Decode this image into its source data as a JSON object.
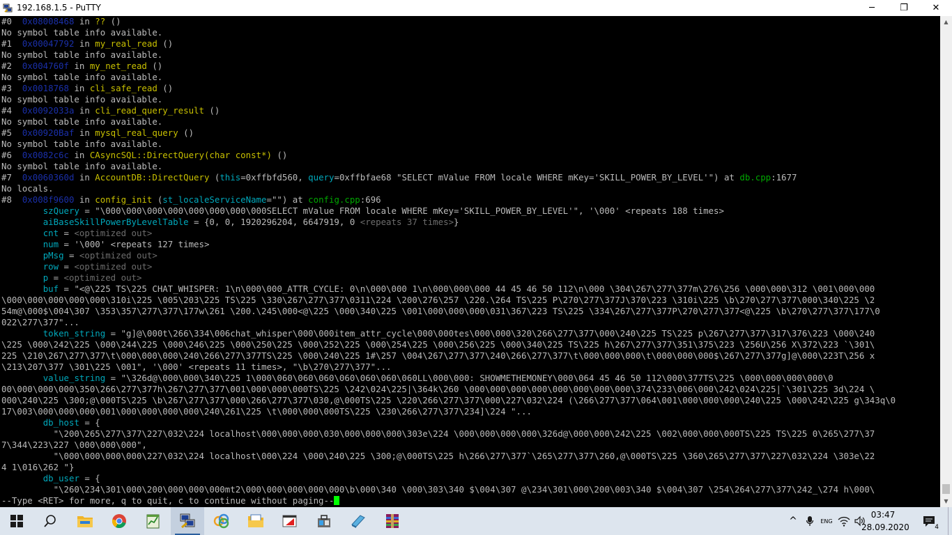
{
  "window": {
    "title": "192.168.1.5 - PuTTY",
    "icon": "putty-icon",
    "controls": {
      "minimize": "─",
      "maximize": "❐",
      "close": "✕"
    }
  },
  "terminal": {
    "colors": {
      "background": "#000000",
      "text": "#bbbbbb",
      "address": "#1a2fa8",
      "function": "#c8c000",
      "variable": "#00a8bb",
      "file": "#00a800",
      "dim": "#6d6d6d",
      "cursor": "#00ff00"
    },
    "lines": [
      [
        [
          "#0  ",
          "norm"
        ],
        [
          "0x08008468",
          "addr"
        ],
        [
          " in ",
          "norm"
        ],
        [
          "??",
          "func"
        ],
        [
          " ()",
          "norm"
        ]
      ],
      [
        [
          "No symbol table info available.",
          "norm"
        ]
      ],
      [
        [
          "#1  ",
          "norm"
        ],
        [
          "0x00047792",
          "addr"
        ],
        [
          " in ",
          "norm"
        ],
        [
          "my_real_read",
          "func"
        ],
        [
          " ()",
          "norm"
        ]
      ],
      [
        [
          "No symbol table info available.",
          "norm"
        ]
      ],
      [
        [
          "#2  ",
          "norm"
        ],
        [
          "0x004760f",
          "addr"
        ],
        [
          " in ",
          "norm"
        ],
        [
          "my_net_read",
          "func"
        ],
        [
          " ()",
          "norm"
        ]
      ],
      [
        [
          "No symbol table info available.",
          "norm"
        ]
      ],
      [
        [
          "#3  ",
          "norm"
        ],
        [
          "0x0018768",
          "addr"
        ],
        [
          " in ",
          "norm"
        ],
        [
          "cli_safe_read",
          "func"
        ],
        [
          " ()",
          "norm"
        ]
      ],
      [
        [
          "No symbol table info available.",
          "norm"
        ]
      ],
      [
        [
          "#4  ",
          "norm"
        ],
        [
          "0x0092033a",
          "addr"
        ],
        [
          " in ",
          "norm"
        ],
        [
          "cli_read_query_result",
          "func"
        ],
        [
          " ()",
          "norm"
        ]
      ],
      [
        [
          "No symbol table info available.",
          "norm"
        ]
      ],
      [
        [
          "#5  ",
          "norm"
        ],
        [
          "0x00920Baf",
          "addr"
        ],
        [
          " in ",
          "norm"
        ],
        [
          "mysql_real_query",
          "func"
        ],
        [
          " ()",
          "norm"
        ]
      ],
      [
        [
          "No symbol table info available.",
          "norm"
        ]
      ],
      [
        [
          "#6  ",
          "norm"
        ],
        [
          "0x0082c6c",
          "addr"
        ],
        [
          " in ",
          "norm"
        ],
        [
          "CAsyncSQL::DirectQuery(char const*)",
          "func"
        ],
        [
          " ()",
          "norm"
        ]
      ],
      [
        [
          "No symbol table info available.",
          "norm"
        ]
      ],
      [
        [
          "#7  ",
          "norm"
        ],
        [
          "0x0060360d",
          "addr"
        ],
        [
          " in ",
          "norm"
        ],
        [
          "AccountDB::DirectQuery",
          "func"
        ],
        [
          " (",
          "norm"
        ],
        [
          "this",
          "var"
        ],
        [
          "=0xffbfd560, ",
          "norm"
        ],
        [
          "query",
          "var"
        ],
        [
          "=0xffbfae68 \"SELECT mValue FROM locale WHERE mKey='SKILL_POWER_BY_LEVEL'\") at ",
          "norm"
        ],
        [
          "db.cpp",
          "file"
        ],
        [
          ":1677",
          "norm"
        ]
      ],
      [
        [
          "No locals.",
          "norm"
        ]
      ],
      [
        [
          "#8  ",
          "norm"
        ],
        [
          "0x008f9600",
          "addr"
        ],
        [
          " in ",
          "norm"
        ],
        [
          "config_init",
          "func"
        ],
        [
          " (",
          "norm"
        ],
        [
          "st_localeServiceName",
          "var"
        ],
        [
          "=\"\") at ",
          "norm"
        ],
        [
          "config.cpp",
          "file"
        ],
        [
          ":696",
          "norm"
        ]
      ],
      [
        [
          "        ",
          "norm"
        ],
        [
          "szQuery",
          "var"
        ],
        [
          " = \"\\000\\000\\000\\000\\000\\000\\000\\000SELECT mValue FROM locale WHERE mKey='SKILL_POWER_BY_LEVEL'\", '\\000' <repeats 188 times>",
          "norm"
        ]
      ],
      [
        [
          "        ",
          "norm"
        ],
        [
          "aiBaseSkillPowerByLevelTable",
          "var"
        ],
        [
          " = {0, 0, 1920296204, 6647919, 0 ",
          "norm"
        ],
        [
          "<repeats 37 times>",
          "dim"
        ],
        [
          "}",
          "norm"
        ]
      ],
      [
        [
          "        ",
          "norm"
        ],
        [
          "cnt",
          "var"
        ],
        [
          " = ",
          "norm"
        ],
        [
          "<optimized out>",
          "dim"
        ]
      ],
      [
        [
          "        ",
          "norm"
        ],
        [
          "num",
          "var"
        ],
        [
          " = '\\000' <repeats 127 times>",
          "norm"
        ]
      ],
      [
        [
          "        ",
          "norm"
        ],
        [
          "pMsg",
          "var"
        ],
        [
          " = ",
          "norm"
        ],
        [
          "<optimized out>",
          "dim"
        ]
      ],
      [
        [
          "        ",
          "norm"
        ],
        [
          "row",
          "var"
        ],
        [
          " = ",
          "norm"
        ],
        [
          "<optimized out>",
          "dim"
        ]
      ],
      [
        [
          "        ",
          "norm"
        ],
        [
          "p",
          "var"
        ],
        [
          " = ",
          "norm"
        ],
        [
          "<optimized out>",
          "dim"
        ]
      ],
      [
        [
          "        ",
          "norm"
        ],
        [
          "buf",
          "var"
        ],
        [
          " = \"<@\\225 TS\\225 CHAT_WHISPER: 1\\n\\000\\000_ATTR_CYCLE: 0\\n\\000\\000 1\\n\\000\\000\\000 44 45 46 50 112\\n\\000 \\304\\267\\277\\377m\\276\\256 \\000\\000\\312 \\001\\000\\000",
          "norm"
        ]
      ],
      [
        [
          "\\000\\000\\000\\000\\000\\310i\\225 \\005\\203\\225 TS\\225 \\330\\267\\277\\377\\0311\\224 \\200\\276\\257 \\220.\\264 TS\\225 P\\270\\277\\377J\\370\\223 \\310i\\225 \\b\\270\\277\\377\\000\\340\\225 \\2",
          "norm"
        ]
      ],
      [
        [
          "54m@\\000$\\004\\307 \\353\\357\\277\\377\\177w\\261 \\200.\\245\\000<@\\225 \\000\\340\\225 \\001\\000\\000\\000\\031\\367\\223 TS\\225 \\334\\267\\277\\377P\\270\\277\\377<@\\225 \\b\\270\\277\\377\\177\\0",
          "norm"
        ]
      ],
      [
        [
          "022\\277\\377\"...",
          "norm"
        ]
      ],
      [
        [
          "        ",
          "norm"
        ],
        [
          "token_string",
          "var"
        ],
        [
          " = \"g]@\\000t\\266\\334\\006chat_whisper\\000\\000item_attr_cycle\\000\\000tes\\000\\000\\320\\266\\277\\377\\000\\240\\225 TS\\225 p\\267\\277\\377\\317\\376\\223 \\000\\240",
          "norm"
        ]
      ],
      [
        [
          "\\225 \\000\\242\\225 \\000\\244\\225 \\000\\246\\225 \\000\\250\\225 \\000\\252\\225 \\000\\254\\225 \\000\\256\\225 \\000\\340\\225 TS\\225 h\\267\\277\\377\\351\\375\\223 \\256U\\256 X\\372\\223 `\\301\\",
          "norm"
        ]
      ],
      [
        [
          "225 \\210\\267\\277\\377\\t\\000\\000\\000\\240\\266\\277\\377TS\\225 \\000\\240\\225 1#\\257 \\004\\267\\277\\377\\240\\266\\277\\377\\t\\000\\000\\000\\t\\000\\000\\000$\\267\\277\\377g]@\\000\\223T\\256 x",
          "norm"
        ]
      ],
      [
        [
          "\\213\\207\\377 \\301\\225 \\001\", '\\000' <repeats 11 times>, \"\\b\\270\\277\\377\"...",
          "norm"
        ]
      ],
      [
        [
          "        ",
          "norm"
        ],
        [
          "value_string",
          "var"
        ],
        [
          " = \"\\326d@\\000\\000\\340\\225 1\\000\\060\\060\\060\\060\\060\\060\\060LL\\000\\000: SHOWMETHEMONEY\\000\\064 45 46 50 112\\000\\377TS\\225 \\000\\000\\000\\000\\0",
          "norm"
        ]
      ],
      [
        [
          "00\\000\\000\\000\\350\\266\\277\\377h\\267\\277\\377\\001\\000\\000\\000TS\\225 \\242\\024\\225|\\364k\\260 \\000\\000\\000\\000\\000\\000\\000\\000\\374\\233\\006\\000\\242\\024\\225|`\\301\\225 3d\\224 \\",
          "norm"
        ]
      ],
      [
        [
          "000\\240\\225 \\300;@\\000TS\\225 \\b\\267\\277\\377\\000\\266\\277\\377\\030,@\\000TS\\225 \\220\\266\\277\\377\\000\\227\\032\\224 (\\266\\277\\377\\064\\001\\000\\000\\000\\240\\225 \\000\\242\\225 g\\343q\\0",
          "norm"
        ]
      ],
      [
        [
          "17\\003\\000\\000\\000\\001\\000\\000\\000\\000\\240\\261\\225 \\t\\000\\000\\000TS\\225 \\230\\266\\277\\377\\234]\\224 \"...",
          "norm"
        ]
      ],
      [
        [
          "        ",
          "norm"
        ],
        [
          "db_host",
          "var"
        ],
        [
          " = {",
          "norm"
        ]
      ],
      [
        [
          "          \"\\200\\265\\277\\377\\227\\032\\224 localhost\\000\\000\\000\\030\\000\\000\\000\\303e\\224 \\000\\000\\000\\000\\326d@\\000\\000\\242\\225 \\002\\000\\000\\000TS\\225 TS\\225 0\\265\\277\\37",
          "norm"
        ]
      ],
      [
        [
          "7\\344\\223\\227 \\000\\000\\000\",",
          "norm"
        ]
      ],
      [
        [
          "          \"\\000\\000\\000\\000\\227\\032\\224 localhost\\000\\224 \\000\\240\\225 \\300;@\\000TS\\225 h\\266\\277\\377`\\265\\277\\377\\260,@\\000TS\\225 \\360\\265\\277\\377\\227\\032\\224 \\303e\\22",
          "norm"
        ]
      ],
      [
        [
          "4 1\\016\\262 \"}",
          "norm"
        ]
      ],
      [
        [
          "        ",
          "norm"
        ],
        [
          "db_user",
          "var"
        ],
        [
          " = {",
          "norm"
        ]
      ],
      [
        [
          "          \"\\260\\234\\301\\000\\200\\000\\000\\000mt2\\000\\000\\000\\000\\000\\b\\000\\340 \\000\\303\\340 $\\004\\307 @\\234\\301\\000\\200\\003\\340 $\\004\\307 \\254\\264\\277\\377\\242_\\274 h\\000\\",
          "norm"
        ]
      ],
      [
        [
          "--Type <RET> for more, q to quit, c to continue without paging--",
          "norm"
        ]
      ]
    ]
  },
  "scrollbar": {
    "up": "▲",
    "down": "▼",
    "position": 0.98
  },
  "taskbar": {
    "apps": [
      {
        "name": "start-button",
        "icon": "windows-logo-icon"
      },
      {
        "name": "search-button",
        "icon": "search-icon"
      },
      {
        "name": "file-explorer",
        "icon": "folder-icon"
      },
      {
        "name": "chrome",
        "icon": "chrome-icon"
      },
      {
        "name": "task-app",
        "icon": "notepad-chart-icon"
      },
      {
        "name": "putty",
        "icon": "putty-icon",
        "active": true
      },
      {
        "name": "network-app",
        "icon": "rings-icon"
      },
      {
        "name": "image-viewer",
        "icon": "folder-photo-icon"
      },
      {
        "name": "navicat",
        "icon": "red-window-icon"
      },
      {
        "name": "app-manager",
        "icon": "toolbox-icon"
      },
      {
        "name": "notes-app",
        "icon": "blue-page-icon"
      },
      {
        "name": "winrar",
        "icon": "winrar-icon"
      }
    ],
    "tray": {
      "chevron": "^",
      "language": "ENG",
      "clock": {
        "time": "03:47",
        "date": "28.09.2020"
      },
      "notification_count": "4"
    }
  }
}
